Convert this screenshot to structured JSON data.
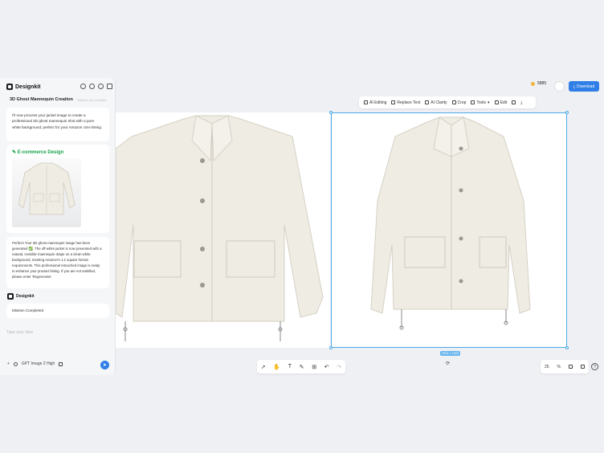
{
  "app": {
    "name": "Designkit"
  },
  "panel": {
    "title": "3D Ghost Mannequin Creation",
    "subtitle": "Stream, pre-creation",
    "intro_message": "I'll now process your jacket image to create a professional 3D ghost mannequin shot with a pure white background, perfect for your Amazon USA listing.",
    "section_label": "E-commerce Design",
    "result_message": "Perfect! Your 3D ghost mannequin image has been generated ✅. The off-white jacket is now presented with a natural, invisible mannequin drape on a clean white background, meeting Amazon's 1:1 square format requirements. This professional retouched image is ready to enhance your product listing. If you are not satisfied, please enter 'Regenerate'.",
    "agent_name": "Designkit",
    "status_message": "Mission Completed",
    "input_placeholder": "Type your idea",
    "model_label": "GPT Image 2 High"
  },
  "topright": {
    "credits": "5885",
    "download_label": "Download"
  },
  "toolbar": {
    "items": [
      "AI Editing",
      "Replace Text",
      "AI Clarity",
      "Crop",
      "Tools",
      "Edit"
    ]
  },
  "canvas": {
    "size_tag": "1024 × 1024"
  },
  "zoom": {
    "value": "25",
    "unit": "%"
  },
  "colors": {
    "accent": "#2f7fe6",
    "selection": "#4aa9e8",
    "green": "#1aa34a",
    "jacket": "#efece3"
  }
}
